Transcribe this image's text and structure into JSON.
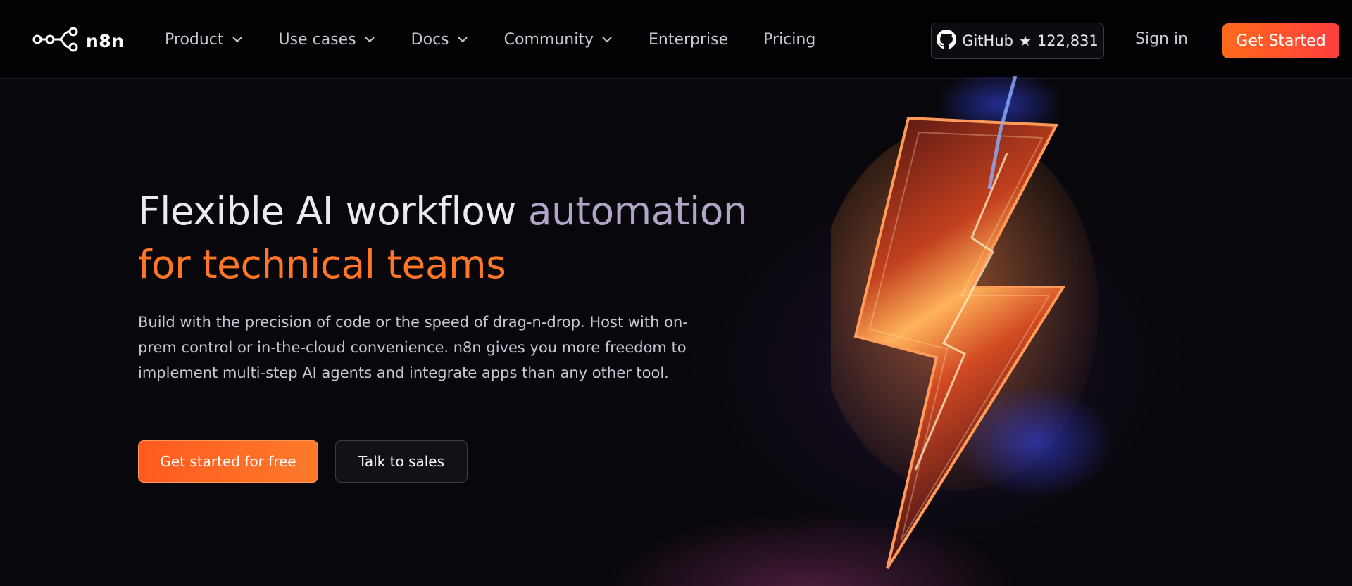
{
  "nav": {
    "brand": "n8n",
    "menu": [
      {
        "label": "Product",
        "has_dropdown": true
      },
      {
        "label": "Use cases",
        "has_dropdown": true
      },
      {
        "label": "Docs",
        "has_dropdown": true
      },
      {
        "label": "Community",
        "has_dropdown": true
      },
      {
        "label": "Enterprise",
        "has_dropdown": false
      },
      {
        "label": "Pricing",
        "has_dropdown": false
      }
    ],
    "github": {
      "label": "GitHub",
      "stars": "122,831"
    },
    "signin": "Sign in",
    "cta": "Get Started"
  },
  "hero": {
    "title_part1": "Flexible AI workflow ",
    "title_part2": "automation",
    "title_part3": "for technical teams",
    "description": "Build with the precision of code or the speed of drag-n-drop. Host with on-prem control or in-the-cloud convenience. n8n gives you more freedom to implement multi-step AI agents and integrate apps than any other tool.",
    "primary_button": "Get started for free",
    "secondary_button": "Talk to sales"
  },
  "colors": {
    "accent": "#ff6a1a",
    "background": "#08070b",
    "title_muted": "#b2a4c7"
  },
  "icons": [
    "n8n-logo-icon",
    "chevron-down-icon",
    "github-icon",
    "star-icon",
    "lightning-bolt-icon"
  ]
}
